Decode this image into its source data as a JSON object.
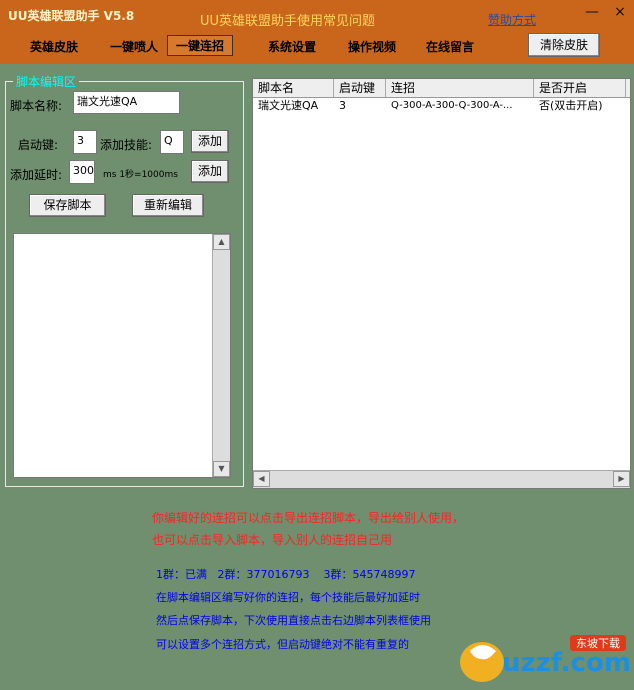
{
  "window": {
    "title": "UU英雄联盟助手 V5.8",
    "help_link": "UU英雄联盟助手使用常见问题",
    "sponsor_link": "赞助方式",
    "minimize": "—",
    "close": "×"
  },
  "menu": {
    "items": [
      "英雄皮肤",
      "一键喷人",
      "一键连招",
      "系统设置",
      "操作视频",
      "在线留言"
    ],
    "clear_skin": "清除皮肤"
  },
  "editor": {
    "group_title": "脚本编辑区",
    "name_label": "脚本名称:",
    "name_value": "瑞文光速QA",
    "start_key_label": "启动键:",
    "start_key_value": "3",
    "add_skill_label": "添加技能:",
    "add_skill_value": "Q",
    "add_skill_button": "添加",
    "add_delay_label": "添加延时:",
    "add_delay_value": "300",
    "delay_hint": "ms 1秒=1000ms",
    "add_delay_button": "添加",
    "save_button": "保存脚本",
    "reedit_button": "重新编辑"
  },
  "script_list": {
    "columns": [
      "脚本名",
      "启动键",
      "连招",
      "是否开启"
    ],
    "rows": [
      {
        "name": "瑞文光速QA",
        "key": "3",
        "combo": "Q-300-A-300-Q-300-A-...",
        "enabled": "否(双击开启)"
      }
    ]
  },
  "tips": {
    "red_line1": "你编辑好的连招可以点击导出连招脚本，导出给别人使用，",
    "red_line2": "也可以点击导入脚本，导入别人的连招自己用",
    "groups": "1群：已满   2群：377016793    3群：545748997",
    "blue_line1": "在脚本编辑区编写好你的连招，每个技能后最好加延时",
    "blue_line2": "然后点保存脚本，下次使用直接点击右边脚本列表框使用",
    "blue_line3": "可以设置多个连招方式，但启动键绝对不能有重复的"
  },
  "watermark": {
    "site": "uzzf.com",
    "brand": "东坡下载"
  },
  "colors": {
    "title_bg": "#c9661b",
    "body_bg": "#6f8f6f",
    "tip_red": "#ff2222",
    "tip_blue": "#0000ee"
  }
}
